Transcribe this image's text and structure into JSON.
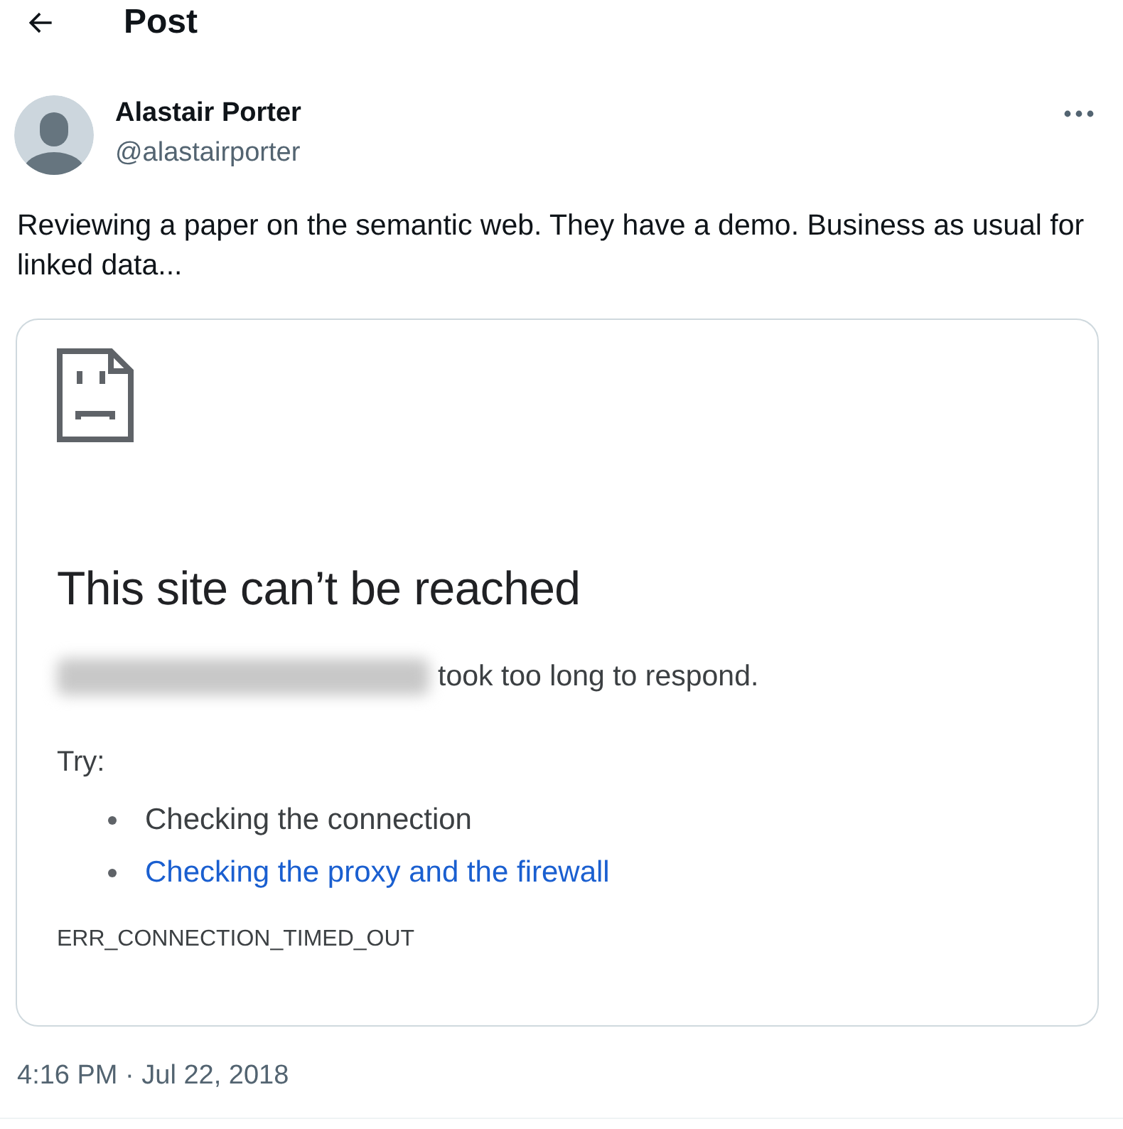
{
  "header": {
    "title": "Post"
  },
  "post": {
    "author": "Alastair Porter",
    "handle": "@alastairporter",
    "text": "Reviewing a paper on the semantic web. They have a demo. Business as usual for linked data...",
    "timestamp": "4:16 PM · Jul 22, 2018"
  },
  "embedded_screenshot": {
    "title": "This site can’t be reached",
    "message": "took too long to respond.",
    "try_label": "Try:",
    "suggestions": [
      {
        "text": "Checking the connection",
        "kind": "text"
      },
      {
        "text": "Checking the proxy and the firewall",
        "kind": "link"
      }
    ],
    "error_code": "ERR_CONNECTION_TIMED_OUT"
  }
}
